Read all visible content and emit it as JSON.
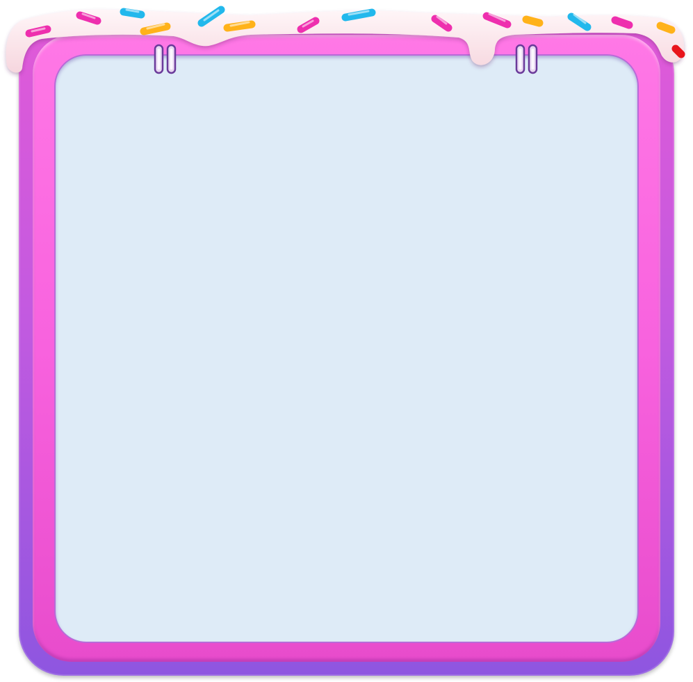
{
  "frame": {
    "outer_color_top": "#e05ad8",
    "outer_color_bottom": "#8e56e0",
    "ring_color": "#f862de",
    "panel_color": "#deebf7",
    "icing_color": "#fbe6ea"
  },
  "decorations": {
    "icing": "icing-drip-top",
    "sprinkle_colors": [
      "#ee2fae",
      "#22b8ec",
      "#ffb21a",
      "#e8151c"
    ],
    "clips": [
      "paper-clip-icon",
      "paper-clip-icon"
    ]
  }
}
